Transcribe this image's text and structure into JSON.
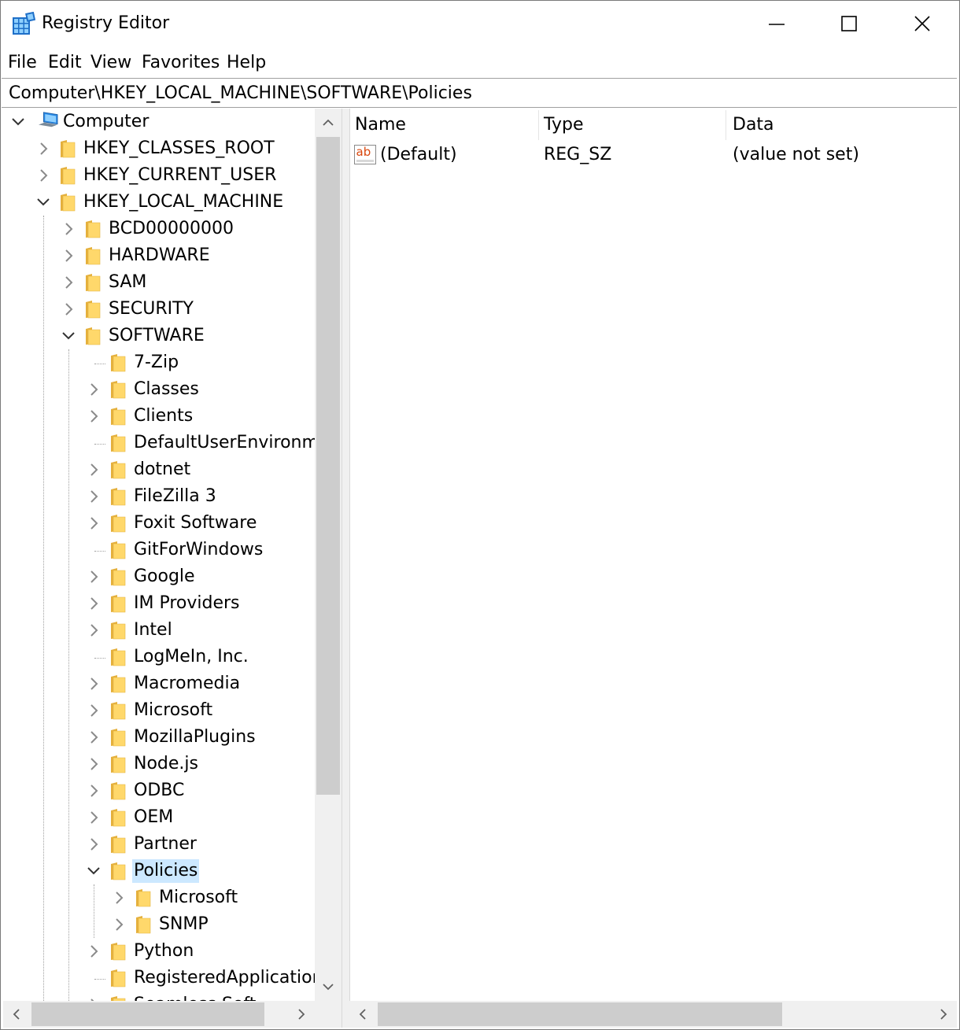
{
  "window": {
    "title": "Registry Editor",
    "controls": {
      "minimize": "minimize",
      "maximize": "maximize",
      "close": "close"
    }
  },
  "menu": [
    "File",
    "Edit",
    "View",
    "Favorites",
    "Help"
  ],
  "address": "Computer\\HKEY_LOCAL_MACHINE\\SOFTWARE\\Policies",
  "tree": {
    "root": "Computer",
    "hives": [
      "HKEY_CLASSES_ROOT",
      "HKEY_CURRENT_USER",
      "HKEY_LOCAL_MACHINE"
    ],
    "hklm_children": [
      "BCD00000000",
      "HARDWARE",
      "SAM",
      "SECURITY",
      "SOFTWARE"
    ],
    "software_children": [
      "7-Zip",
      "Classes",
      "Clients",
      "DefaultUserEnvironm",
      "dotnet",
      "FileZilla 3",
      "Foxit Software",
      "GitForWindows",
      "Google",
      "IM Providers",
      "Intel",
      "LogMeIn, Inc.",
      "Macromedia",
      "Microsoft",
      "MozillaPlugins",
      "Node.js",
      "ODBC",
      "OEM",
      "Partner",
      "Policies",
      "Python",
      "RegisteredApplicatior",
      "Seamless Soft"
    ],
    "policies_children": [
      "Microsoft",
      "SNMP"
    ],
    "selected": "Policies"
  },
  "list": {
    "columns": [
      "Name",
      "Type",
      "Data"
    ],
    "rows": [
      {
        "name": "(Default)",
        "type": "REG_SZ",
        "data": "(value not set)",
        "icon_text": "ab"
      }
    ]
  },
  "colors": {
    "selection": "#cce8ff",
    "folder": "#ffd86b",
    "scroll_thumb": "#cdcdcd",
    "scroll_track": "#f0f0f0",
    "reg_icon_text": "#d9480f"
  }
}
